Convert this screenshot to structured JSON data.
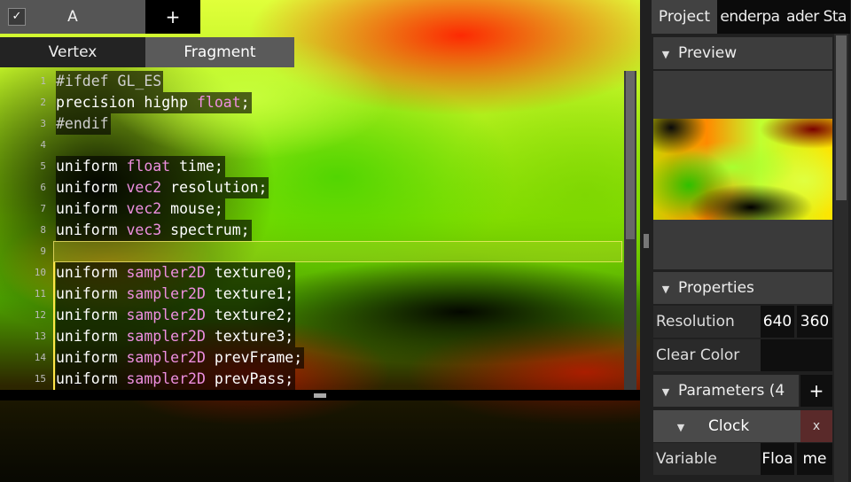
{
  "doc_tabs": {
    "active_label": "A",
    "check_glyph": "✓",
    "add_label": "+"
  },
  "editor_tabs": {
    "vertex": "Vertex",
    "fragment": "Fragment"
  },
  "code_lines": [
    {
      "n": "1",
      "tokens": [
        {
          "c": "pp",
          "t": "#ifdef GL_ES"
        }
      ]
    },
    {
      "n": "2",
      "tokens": [
        {
          "c": "kw",
          "t": "precision highp "
        },
        {
          "c": "ty",
          "t": "float"
        },
        {
          "c": "kw",
          "t": ";"
        }
      ]
    },
    {
      "n": "3",
      "tokens": [
        {
          "c": "pp",
          "t": "#endif"
        }
      ]
    },
    {
      "n": "4",
      "tokens": []
    },
    {
      "n": "5",
      "tokens": [
        {
          "c": "kw",
          "t": "uniform "
        },
        {
          "c": "ty",
          "t": "float"
        },
        {
          "c": "id",
          "t": " time;"
        }
      ]
    },
    {
      "n": "6",
      "tokens": [
        {
          "c": "kw",
          "t": "uniform "
        },
        {
          "c": "ty",
          "t": "vec2"
        },
        {
          "c": "id",
          "t": " resolution;"
        }
      ]
    },
    {
      "n": "7",
      "tokens": [
        {
          "c": "kw",
          "t": "uniform "
        },
        {
          "c": "ty",
          "t": "vec2"
        },
        {
          "c": "id",
          "t": " mouse;"
        }
      ]
    },
    {
      "n": "8",
      "tokens": [
        {
          "c": "kw",
          "t": "uniform "
        },
        {
          "c": "ty",
          "t": "vec3"
        },
        {
          "c": "id",
          "t": " spectrum;"
        }
      ]
    },
    {
      "n": "9",
      "tokens": []
    },
    {
      "n": "10",
      "tokens": [
        {
          "c": "kw",
          "t": "uniform "
        },
        {
          "c": "ty",
          "t": "sampler2D"
        },
        {
          "c": "id",
          "t": " texture0;"
        }
      ]
    },
    {
      "n": "11",
      "tokens": [
        {
          "c": "kw",
          "t": "uniform "
        },
        {
          "c": "ty",
          "t": "sampler2D"
        },
        {
          "c": "id",
          "t": " texture1;"
        }
      ]
    },
    {
      "n": "12",
      "tokens": [
        {
          "c": "kw",
          "t": "uniform "
        },
        {
          "c": "ty",
          "t": "sampler2D"
        },
        {
          "c": "id",
          "t": " texture2;"
        }
      ]
    },
    {
      "n": "13",
      "tokens": [
        {
          "c": "kw",
          "t": "uniform "
        },
        {
          "c": "ty",
          "t": "sampler2D"
        },
        {
          "c": "id",
          "t": " texture3;"
        }
      ]
    },
    {
      "n": "14",
      "tokens": [
        {
          "c": "kw",
          "t": "uniform "
        },
        {
          "c": "ty",
          "t": "sampler2D"
        },
        {
          "c": "id",
          "t": " prevFrame;"
        }
      ]
    },
    {
      "n": "15",
      "tokens": [
        {
          "c": "kw",
          "t": "uniform "
        },
        {
          "c": "ty",
          "t": "sampler2D"
        },
        {
          "c": "id",
          "t": " prevPass;"
        }
      ]
    }
  ],
  "sidebar": {
    "tabs": {
      "project": "Project",
      "render": "enderpa",
      "shader": "ader Sta"
    },
    "preview_header": "Preview",
    "properties_header": "Properties",
    "resolution": {
      "label": "Resolution",
      "width": "640",
      "height": "360"
    },
    "clear_color": {
      "label": "Clear Color"
    },
    "parameters_header": "Parameters (4",
    "add_param": "+",
    "clock": {
      "label": "Clock",
      "remove": "x"
    },
    "variable": {
      "label": "Variable",
      "type": "Floa",
      "name": "me"
    },
    "collapse_glyph": "▼"
  },
  "colors": {
    "keyword": "#ffffff",
    "type": "#ee8fe0",
    "highlight": "#ffe54a"
  }
}
